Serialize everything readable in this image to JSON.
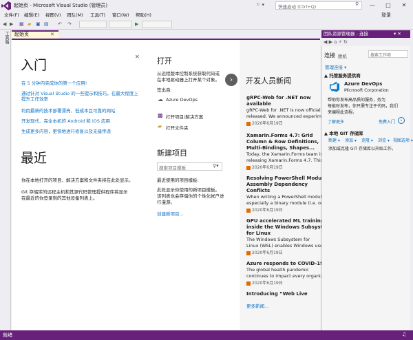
{
  "window": {
    "title": "起始页 - Microsoft Visual Studio (管理员)",
    "quicklaunch_placeholder": "快速启动 (Ctrl+Q)",
    "signin": "登录",
    "minimize": "—",
    "maximize": "□",
    "close": "✕"
  },
  "menu": [
    "文件(F)",
    "编辑(E)",
    "视图(V)",
    "团队(M)",
    "工具(T)",
    "窗口(W)",
    "帮助(H)"
  ],
  "sidebar": {
    "toolbox": "工具箱"
  },
  "tab": {
    "label": "起始页",
    "close": "✕"
  },
  "get_started": {
    "heading": "入门",
    "links": [
      "在 5 分钟内完成你的第一个应用!",
      "通过针对 Visual Studio 的一些提示和技巧，在最大程度上提升工作效率",
      "利用最新的技术部署漂亮、低成本且可靠的网站",
      "开发现代、完全本机的 Android 和 iOS 应用",
      "生成更多内容，更快地进行修复以及无缝传递"
    ]
  },
  "recent": {
    "heading": "最近",
    "line1": "你在本地打开的项目、解决方案和文件夹将在此处显示。",
    "line2a": "Git 存储库的远程主机和其源代码管理提供程序将显示",
    "line2b": "在最近的你登录到的其他设备列表上。"
  },
  "open": {
    "heading": "打开",
    "desc1": "从远程版本控制系统获取代码或",
    "desc2": "在本地驱动器上打开某个对象。",
    "signin_label": "签出自:",
    "azure": "Azure DevOps",
    "project": "打开项目/解决方案",
    "folder": "打开文件夹"
  },
  "new_project": {
    "heading": "新建项目",
    "search_placeholder": "搜索项目模板",
    "recent_label": "最近使用的项目模板:",
    "desc1": "此处显示你使用的新项目模板。",
    "desc2": "该列表也会存储你的个性化帐户进",
    "desc3": "行漫游。",
    "create": "创建新项目..."
  },
  "news": {
    "heading": "开发人员新闻",
    "items": [
      {
        "title": [
          "gRPC-Web for .NET now",
          "available"
        ],
        "body": [
          "gRPC-Web for .NET is now official",
          "released. We announced experim"
        ],
        "date": "2020年6月19日"
      },
      {
        "title": [
          "Xamarin.Forms 4.7: Grid",
          "Column & Row Definitions,",
          "Multi-Bindings, Shapes..."
        ],
        "body": [
          "Today, the Xamarin.Forms team is",
          "releasing Xamarin.Forms 4.7. This"
        ],
        "date": "2020年6月19日"
      },
      {
        "title": [
          "Resolving PowerShell Module",
          "Assembly Dependency",
          "Conflicts"
        ],
        "body": [
          "When writing a PowerShell module",
          "especially a binary module (i.e. on"
        ],
        "date": "2020年6月19日"
      },
      {
        "title": [
          "GPU accelerated ML training",
          "inside the Windows Subsystem",
          "for Linux"
        ],
        "body": [
          "The Windows Subsystem for",
          "Linux (WSL) enables Windows use"
        ],
        "date": "2020年6月19日"
      },
      {
        "title": [
          "Azure responds to COVID-19"
        ],
        "body": [
          "The global health pandemic",
          "continues to impact every organiz."
        ],
        "date": "2020年6月19日"
      },
      {
        "title": [
          "Introducing “Web Live"
        ],
        "body": [],
        "date": ""
      }
    ],
    "more": "更多新闻..."
  },
  "team_explorer": {
    "title": "团队资源管理器 - 连接",
    "header": "连接",
    "header_sub": "脱机",
    "search_placeholder": "搜索工作项",
    "manage": "管理连接 ▾",
    "hosted_heading": "▲ 托管服务提供商",
    "azure_name": "Azure DevOps",
    "azure_corp": "Microsoft Corporation",
    "azure_desc1": "帮助你发布高品质的服务，务为",
    "azure_desc2": "每能时发布，你只需专注于代码，我们",
    "azure_desc3": "来编程此流程。",
    "learn_more": "了解更多",
    "free_start": "免费入门",
    "local_git_heading": "▲ 本地 GIT 存储库",
    "git_actions": [
      "新建 ▾",
      "添加 ▾",
      "克隆 ▾",
      "浏览 ▾",
      "视图选项 ▾"
    ],
    "git_desc": "添加或克隆 GIT 存储库以开始工作。"
  },
  "status": {
    "text": "就绪"
  }
}
